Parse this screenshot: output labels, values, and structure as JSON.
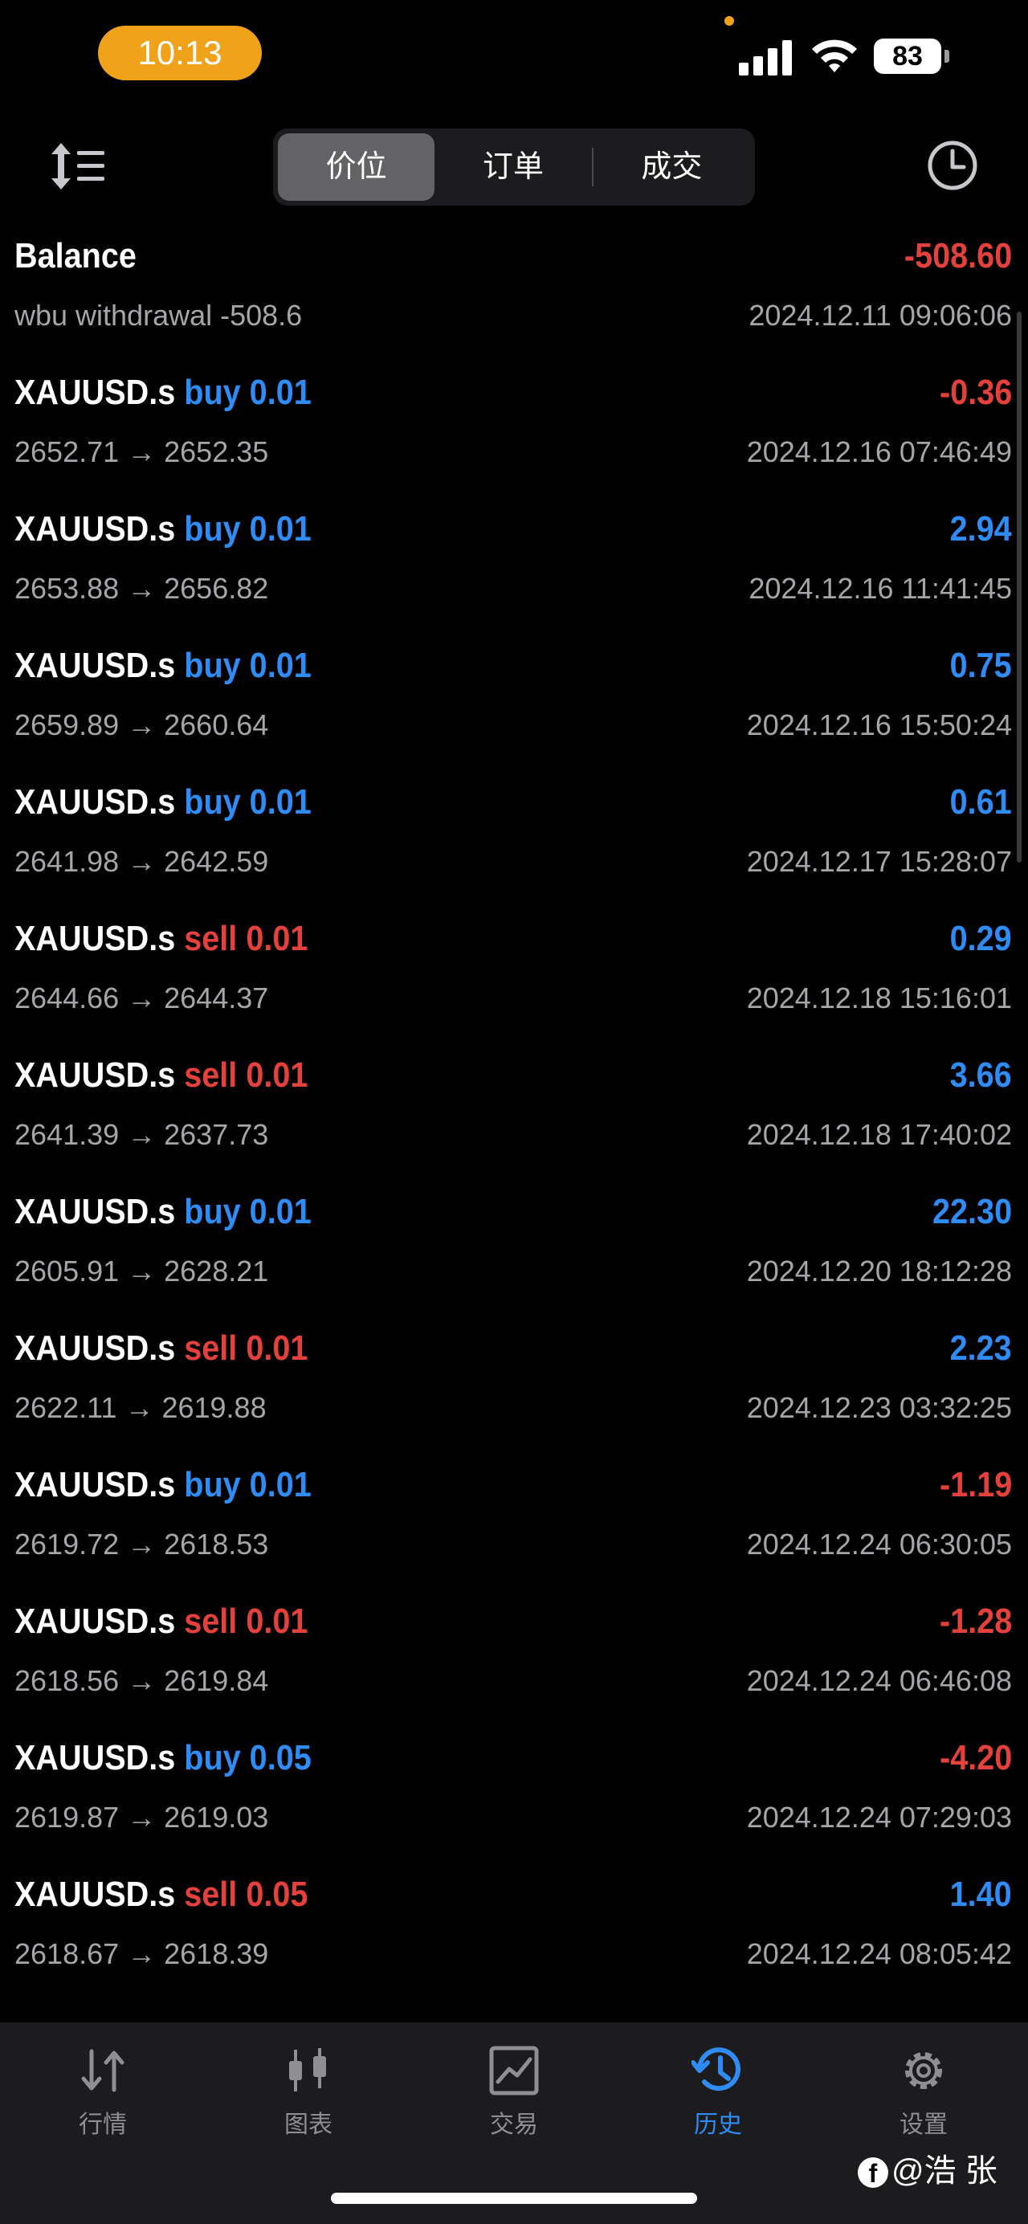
{
  "status_bar": {
    "time": "10:13",
    "battery": "83"
  },
  "header": {
    "tabs": [
      "价位",
      "订单",
      "成交"
    ],
    "active_tab": 0
  },
  "history": [
    {
      "title": "Balance",
      "side": "",
      "volume": "",
      "profit": "-508.60",
      "profit_sign": "neg",
      "detail": "wbu withdrawal -508.6",
      "time": "2024.12.11 09:06:06"
    },
    {
      "title": "XAUUSD.s",
      "side": "buy",
      "volume": "0.01",
      "profit": "-0.36",
      "profit_sign": "neg",
      "detail": "2652.71 → 2652.35",
      "time": "2024.12.16 07:46:49"
    },
    {
      "title": "XAUUSD.s",
      "side": "buy",
      "volume": "0.01",
      "profit": "2.94",
      "profit_sign": "pos",
      "detail": "2653.88 → 2656.82",
      "time": "2024.12.16 11:41:45"
    },
    {
      "title": "XAUUSD.s",
      "side": "buy",
      "volume": "0.01",
      "profit": "0.75",
      "profit_sign": "pos",
      "detail": "2659.89 → 2660.64",
      "time": "2024.12.16 15:50:24"
    },
    {
      "title": "XAUUSD.s",
      "side": "buy",
      "volume": "0.01",
      "profit": "0.61",
      "profit_sign": "pos",
      "detail": "2641.98 → 2642.59",
      "time": "2024.12.17 15:28:07"
    },
    {
      "title": "XAUUSD.s",
      "side": "sell",
      "volume": "0.01",
      "profit": "0.29",
      "profit_sign": "pos",
      "detail": "2644.66 → 2644.37",
      "time": "2024.12.18 15:16:01"
    },
    {
      "title": "XAUUSD.s",
      "side": "sell",
      "volume": "0.01",
      "profit": "3.66",
      "profit_sign": "pos",
      "detail": "2641.39 → 2637.73",
      "time": "2024.12.18 17:40:02"
    },
    {
      "title": "XAUUSD.s",
      "side": "buy",
      "volume": "0.01",
      "profit": "22.30",
      "profit_sign": "pos",
      "detail": "2605.91 → 2628.21",
      "time": "2024.12.20 18:12:28"
    },
    {
      "title": "XAUUSD.s",
      "side": "sell",
      "volume": "0.01",
      "profit": "2.23",
      "profit_sign": "pos",
      "detail": "2622.11 → 2619.88",
      "time": "2024.12.23 03:32:25"
    },
    {
      "title": "XAUUSD.s",
      "side": "buy",
      "volume": "0.01",
      "profit": "-1.19",
      "profit_sign": "neg",
      "detail": "2619.72 → 2618.53",
      "time": "2024.12.24 06:30:05"
    },
    {
      "title": "XAUUSD.s",
      "side": "sell",
      "volume": "0.01",
      "profit": "-1.28",
      "profit_sign": "neg",
      "detail": "2618.56 → 2619.84",
      "time": "2024.12.24 06:46:08"
    },
    {
      "title": "XAUUSD.s",
      "side": "buy",
      "volume": "0.05",
      "profit": "-4.20",
      "profit_sign": "neg",
      "detail": "2619.87 → 2619.03",
      "time": "2024.12.24 07:29:03"
    },
    {
      "title": "XAUUSD.s",
      "side": "sell",
      "volume": "0.05",
      "profit": "1.40",
      "profit_sign": "pos",
      "detail": "2618.67 → 2618.39",
      "time": "2024.12.24 08:05:42"
    }
  ],
  "tabbar": {
    "items": [
      {
        "label": "行情",
        "icon": "quotes-arrows-icon"
      },
      {
        "label": "图表",
        "icon": "candlestick-chart-icon"
      },
      {
        "label": "交易",
        "icon": "trade-chart-icon"
      },
      {
        "label": "历史",
        "icon": "history-clock-icon"
      },
      {
        "label": "设置",
        "icon": "settings-gear-icon"
      }
    ],
    "active_index": 3
  },
  "watermark": {
    "text": "@浩 张"
  },
  "colors": {
    "positive": "#2f8cf5",
    "negative": "#e5413c",
    "status_pill": "#f0a31a",
    "active_tab": "#2f8cf5"
  }
}
